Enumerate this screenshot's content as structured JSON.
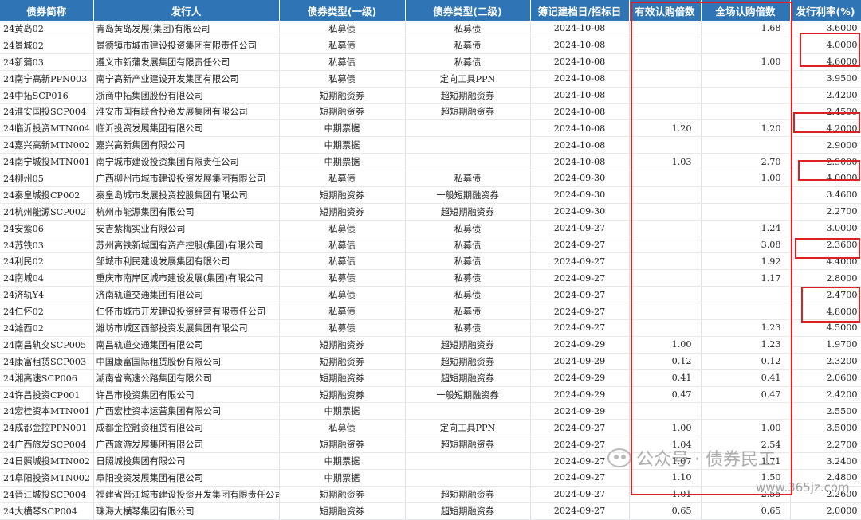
{
  "headers": [
    "债券简称",
    "发行人",
    "债券类型(一级)",
    "债券类型(二级)",
    "簿记建档日/招标日",
    "有效认购倍数",
    "全场认购倍数",
    "发行利率(%)"
  ],
  "rows": [
    [
      "24黄岛02",
      "青岛黄岛发展(集团)有限公司",
      "私募债",
      "私募债",
      "2024-10-08",
      "",
      "1.68",
      "3.6000"
    ],
    [
      "24景城02",
      "景德镇市城市建设投资集团有限责任公司",
      "私募债",
      "私募债",
      "2024-10-08",
      "",
      "",
      "4.0000"
    ],
    [
      "24新蒲03",
      "遵义市新蒲发展集团有限责任公司",
      "私募债",
      "私募债",
      "2024-10-08",
      "",
      "1.00",
      "4.6000"
    ],
    [
      "24南宁高新PPN003",
      "南宁高新产业建设开发集团有限公司",
      "私募债",
      "定向工具PPN",
      "2024-10-08",
      "",
      "",
      "3.9500"
    ],
    [
      "24中拓SCP016",
      "浙商中拓集团股份有限公司",
      "短期融资券",
      "超短期融资券",
      "2024-10-08",
      "",
      "",
      "2.4200"
    ],
    [
      "24淮安国投SCP004",
      "淮安市国有联合投资发展集团有限公司",
      "短期融资券",
      "超短期融资券",
      "2024-10-08",
      "",
      "",
      "2.4500"
    ],
    [
      "24临沂投资MTN004",
      "临沂投资发展集团有限公司",
      "中期票据",
      "",
      "2024-10-08",
      "1.20",
      "1.20",
      "4.2000"
    ],
    [
      "24嘉兴高新MTN002",
      "嘉兴高新集团有限公司",
      "中期票据",
      "",
      "2024-10-08",
      "",
      "",
      "2.9000"
    ],
    [
      "24南宁城投MTN001",
      "南宁城市建设投资集团有限责任公司",
      "中期票据",
      "",
      "2024-10-08",
      "1.03",
      "2.70",
      "2.9000"
    ],
    [
      "24柳州05",
      "广西柳州市城市建设投资发展集团有限公司",
      "私募债",
      "私募债",
      "2024-09-30",
      "",
      "1.00",
      "4.0000"
    ],
    [
      "24秦皇城投CP002",
      "秦皇岛城市发展投资控股集团有限公司",
      "短期融资券",
      "一般短期融资券",
      "2024-09-30",
      "",
      "",
      "3.4600"
    ],
    [
      "24杭州能源SCP002",
      "杭州市能源集团有限公司",
      "短期融资券",
      "超短期融资券",
      "2024-09-30",
      "",
      "",
      "2.2700"
    ],
    [
      "24安紫06",
      "安吉紫梅实业有限公司",
      "私募债",
      "私募债",
      "2024-09-27",
      "",
      "1.24",
      "3.0000"
    ],
    [
      "24苏铁03",
      "苏州高铁新城国有资产控股(集团)有限公司",
      "私募债",
      "私募债",
      "2024-09-27",
      "",
      "3.08",
      "2.3600"
    ],
    [
      "24利民02",
      "邹城市利民建设发展集团有限公司",
      "私募债",
      "私募债",
      "2024-09-27",
      "",
      "1.92",
      "4.4000"
    ],
    [
      "24南城04",
      "重庆市南岸区城市建设发展(集团)有限公司",
      "私募债",
      "私募债",
      "2024-09-27",
      "",
      "1.17",
      "2.8000"
    ],
    [
      "24济轨Y4",
      "济南轨道交通集团有限公司",
      "私募债",
      "私募债",
      "2024-09-27",
      "",
      "",
      "2.4700"
    ],
    [
      "24仁怀02",
      "仁怀市城市开发建设投资经营有限责任公司",
      "私募债",
      "私募债",
      "2024-09-27",
      "",
      "",
      "4.8000"
    ],
    [
      "24潍西02",
      "潍坊市城区西部投资发展集团有限公司",
      "私募债",
      "私募债",
      "2024-09-27",
      "",
      "1.23",
      "4.5000"
    ],
    [
      "24南昌轨交SCP005",
      "南昌轨道交通集团有限公司",
      "短期融资券",
      "超短期融资券",
      "2024-09-29",
      "1.00",
      "1.23",
      "1.9700"
    ],
    [
      "24康富租赁SCP003",
      "中国康富国际租赁股份有限公司",
      "短期融资券",
      "超短期融资券",
      "2024-09-29",
      "0.12",
      "0.12",
      "2.3200"
    ],
    [
      "24湘高速SCP006",
      "湖南省高速公路集团有限公司",
      "短期融资券",
      "超短期融资券",
      "2024-09-29",
      "0.41",
      "0.41",
      "2.0600"
    ],
    [
      "24许昌投资CP001",
      "许昌市投资集团有限公司",
      "短期融资券",
      "一般短期融资券",
      "2024-09-29",
      "0.47",
      "0.47",
      "2.4200"
    ],
    [
      "24宏桂资本MTN001",
      "广西宏桂资本运营集团有限公司",
      "中期票据",
      "",
      "2024-09-29",
      "",
      "",
      "2.5500"
    ],
    [
      "24成都金控PPN001",
      "成都金控融资租赁有限公司",
      "私募债",
      "定向工具PPN",
      "2024-09-27",
      "1.00",
      "1.00",
      "3.5000"
    ],
    [
      "24广西旅发SCP004",
      "广西旅游发展集团有限公司",
      "短期融资券",
      "超短期融资券",
      "2024-09-27",
      "1.04",
      "2.54",
      "2.2700"
    ],
    [
      "24日照城投MTN002",
      "日照城投集团有限公司",
      "中期票据",
      "",
      "2024-09-27",
      "1.07",
      "1.71",
      "3.2400"
    ],
    [
      "24阜阳投资MTN002",
      "阜阳投资发展集团有限公司",
      "中期票据",
      "",
      "2024-09-27",
      "1.10",
      "1.50",
      "2.4800"
    ],
    [
      "24晋江城投SCP004",
      "福建省晋江城市建设投资开发集团有限责任公司",
      "短期融资券",
      "超短期融资券",
      "2024-09-27",
      "1.01",
      "2.55",
      "2.2600"
    ],
    [
      "24大横琴SCP004",
      "珠海大横琴集团有限公司",
      "短期融资券",
      "超短期融资券",
      "2024-09-27",
      "0.65",
      "0.65",
      "2.0000"
    ]
  ],
  "watermark": {
    "text": "公众号 · 债券民工",
    "url": "www.365jz.com"
  },
  "colors": {
    "header_bg": "#2f75b5",
    "highlight": "#e02020"
  }
}
